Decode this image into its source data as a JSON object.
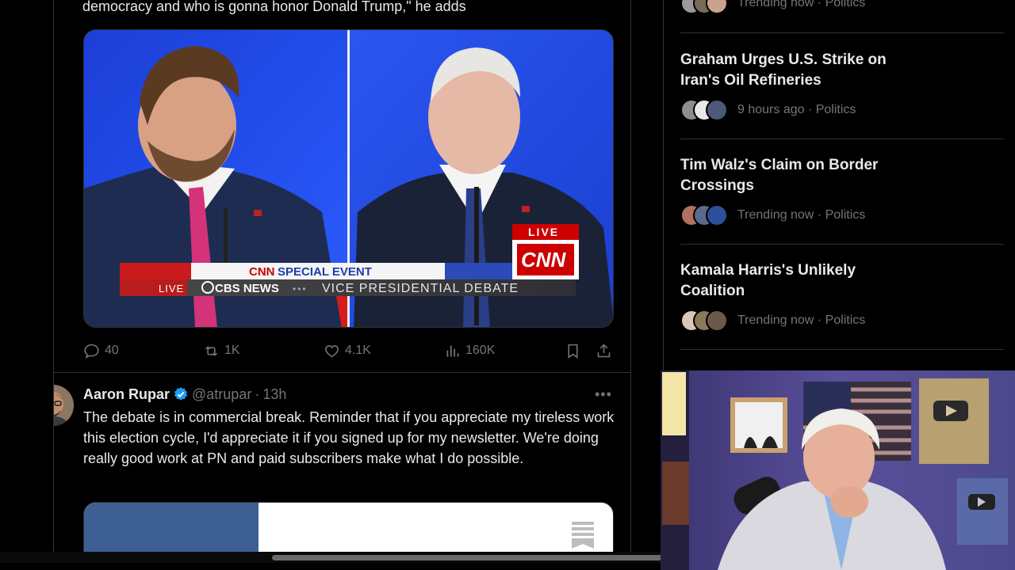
{
  "tweet1": {
    "text_tail": "democracy and who is gonna honor Donald Trump,\" he adds",
    "media": {
      "banner_brand": "CNN",
      "banner_event": "SPECIAL EVENT",
      "live_left": "LIVE",
      "network": "CBS NEWS",
      "bullets": "•••",
      "lower_third": "VICE PRESIDENTIAL DEBATE",
      "live_badge": "LIVE",
      "logo": "CNN"
    },
    "actions": {
      "replies": "40",
      "reposts": "1K",
      "likes": "4.1K",
      "views": "160K"
    }
  },
  "tweet2": {
    "name": "Aaron Rupar",
    "handle": "@atrupar",
    "separator": "·",
    "time": "13h",
    "more": "•••",
    "body": "The debate is in commercial break. Reminder that if you appreciate my tireless work this election cycle, I'd appreciate it if you signed up for my newsletter. We're doing really good work at PN and paid subscribers make what I do possible."
  },
  "sidebar": {
    "trends": [
      {
        "title": "",
        "meta": "Trending now · Politics"
      },
      {
        "title": "Graham Urges U.S. Strike on Iran's Oil Refineries",
        "meta": "9 hours ago · Politics"
      },
      {
        "title": "Tim Walz's Claim on Border Crossings",
        "meta": "Trending now · Politics"
      },
      {
        "title": "Kamala Harris's Unlikely Coalition",
        "meta": "Trending now · Politics"
      }
    ]
  },
  "colors": {
    "background": "#000000",
    "text": "#e7e9ea",
    "muted": "#71767b",
    "border": "#2f3336",
    "verified": "#1d9bf0",
    "cnn_red": "#cc0000"
  }
}
